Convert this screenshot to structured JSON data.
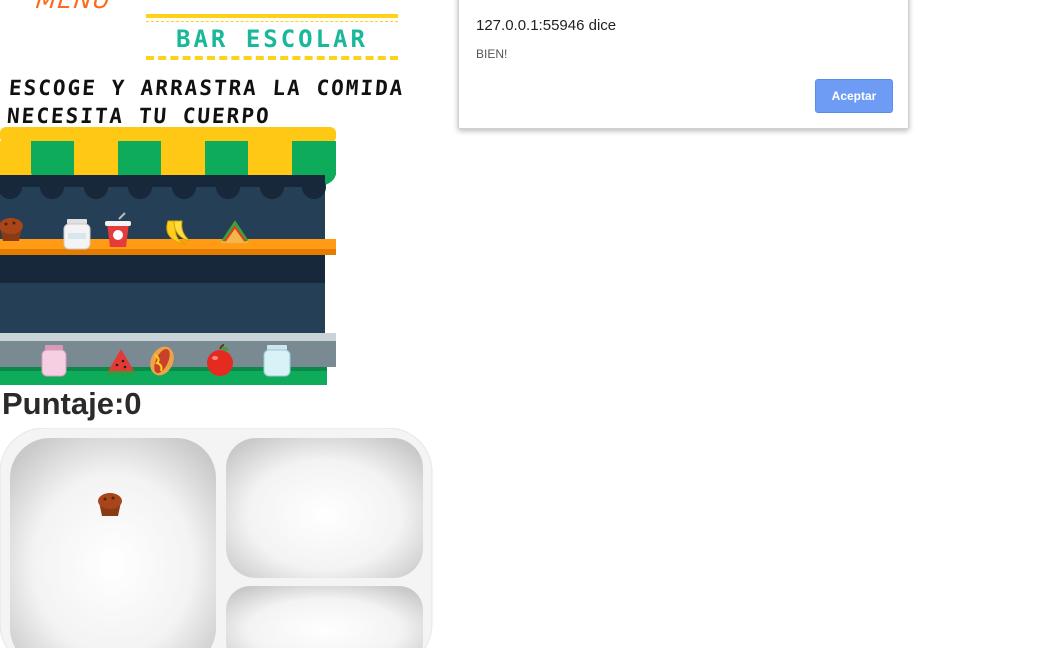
{
  "header": {
    "menu_label": "MENU",
    "title": "BAR ESCOLAR"
  },
  "instructions": {
    "line1": "ESCOGE Y ARRASTRA LA COMIDA",
    "line2": "NECESITA TU CUERPO"
  },
  "score": {
    "label": "Puntaje:",
    "value": "0"
  },
  "shop": {
    "top_shelf_items": [
      "muffin-icon",
      "milk-jar-icon",
      "yogurt-cup-icon",
      "banana-icon",
      "sandwich-icon"
    ],
    "bottom_shelf_items": [
      "pink-jar-icon",
      "watermelon-icon",
      "hotdog-icon",
      "apple-icon",
      "blue-jar-icon"
    ],
    "colors": {
      "awning_yellow": "#ffc814",
      "awning_green": "#0eac5a",
      "dark_back": "#16283a",
      "shelf": "#ff9b14",
      "counter": "#7a8a92",
      "grass": "#0eac5a"
    }
  },
  "tray": {
    "items": [
      "muffin-icon"
    ]
  },
  "dialog": {
    "title": "127.0.0.1:55946 dice",
    "message": "BIEN!",
    "button": "Aceptar"
  }
}
